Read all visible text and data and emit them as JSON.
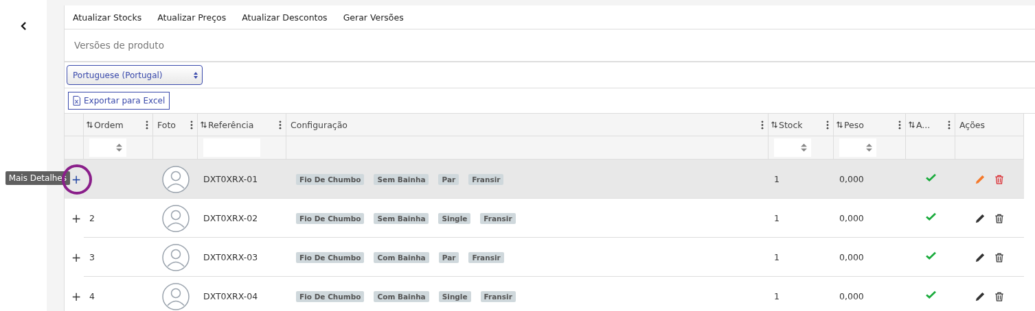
{
  "toolbar": [
    "Atualizar Stocks",
    "Atualizar Preços",
    "Atualizar Descontos",
    "Gerar Versões"
  ],
  "title": "Versões de produto",
  "language_select": {
    "value": "Portuguese (Portugal)"
  },
  "export_button": "Exportar para Excel",
  "table": {
    "columns": [
      {
        "label": "Ordem",
        "sortable": true,
        "menu": true,
        "kind": "number"
      },
      {
        "label": "Foto",
        "sortable": false,
        "menu": true,
        "kind": "plain"
      },
      {
        "label": "Referência",
        "sortable": true,
        "menu": true,
        "kind": "text"
      },
      {
        "label": "Configuração",
        "sortable": false,
        "menu": true,
        "kind": "plain"
      },
      {
        "label": "Stock",
        "sortable": true,
        "menu": true,
        "kind": "number"
      },
      {
        "label": "Peso",
        "sortable": true,
        "menu": true,
        "kind": "number"
      },
      {
        "label": "A...",
        "sortable": true,
        "menu": true,
        "kind": "plain"
      },
      {
        "label": "Ações",
        "sortable": false,
        "menu": false,
        "kind": "plain"
      }
    ],
    "rows": [
      {
        "expander": "+",
        "order": "",
        "reference": "DXT0XRX-01",
        "tags": [
          "Fio De Chumbo",
          "Sem Bainha",
          "Par",
          "Fransir"
        ],
        "stock": "1",
        "weight": "0,000",
        "active": true,
        "hovered": true
      },
      {
        "expander": "+",
        "order": "2",
        "reference": "DXT0XRX-02",
        "tags": [
          "Fio De Chumbo",
          "Sem Bainha",
          "Single",
          "Fransir"
        ],
        "stock": "1",
        "weight": "0,000",
        "active": true,
        "hovered": false
      },
      {
        "expander": "+",
        "order": "3",
        "reference": "DXT0XRX-03",
        "tags": [
          "Fio De Chumbo",
          "Com Bainha",
          "Par",
          "Fransir"
        ],
        "stock": "1",
        "weight": "0,000",
        "active": true,
        "hovered": false
      },
      {
        "expander": "+",
        "order": "4",
        "reference": "DXT0XRX-04",
        "tags": [
          "Fio De Chumbo",
          "Com Bainha",
          "Single",
          "Fransir"
        ],
        "stock": "1",
        "weight": "0,000",
        "active": true,
        "hovered": false
      }
    ]
  },
  "tooltip": "Mais Detalhes"
}
